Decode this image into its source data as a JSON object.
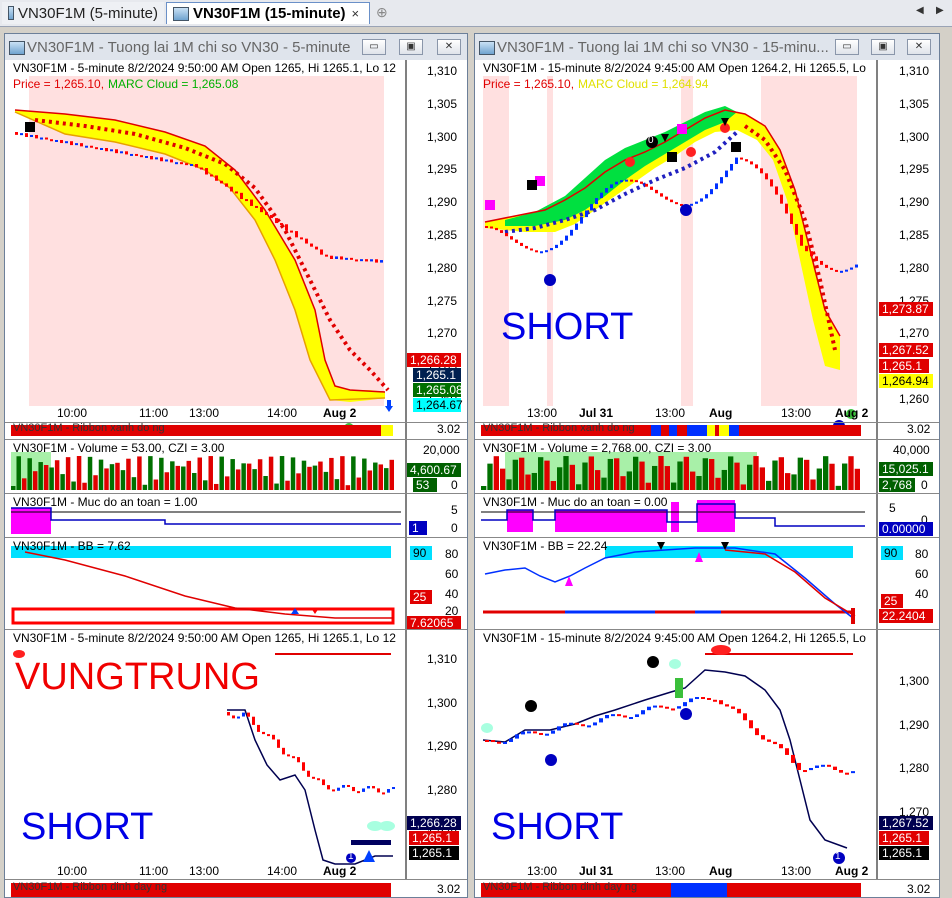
{
  "tabs": [
    {
      "label": "VN30F1M (5-minute)",
      "active": false
    },
    {
      "label": "VN30F1M (15-minute)",
      "active": true
    }
  ],
  "tab_close": "×",
  "tab_add": "⊕",
  "nav_left": "◀",
  "nav_right": "▶",
  "windows": {
    "left": {
      "title": "VN30F1M - Tuong lai 1M chi so VN30 - 5-minute",
      "price_header": "VN30F1M - 5-minute 8/2/2024 9:50:00 AM Open 1265, Hi 1265.1, Lo 12",
      "price_line": "Price = 1,265.10,",
      "marc_line": "MARC Cloud = 1,265.08",
      "y_ticks": [
        "1,310",
        "1,305",
        "1,300",
        "1,295",
        "1,290",
        "1,285",
        "1,280",
        "1,275",
        "1,270",
        "1,265",
        "1,260"
      ],
      "x_ticks": [
        "10:00",
        "11:00",
        "13:00",
        "14:00",
        "Aug 2"
      ],
      "price_tags": [
        "1,266.28",
        "1,265.1",
        "1,265.08",
        "1,264.67"
      ],
      "ribbon_label": "VN30F1M - Ribbon xanh do ng",
      "ribbon_value": "3.02",
      "volume_label": "VN30F1M - Volume = 53.00, CZI = 3.00",
      "volume_ticks": [
        "20,000",
        "0"
      ],
      "volume_tags": [
        "4,600.67",
        "53"
      ],
      "safety_label": "VN30F1M - Muc do an toan = 1.00",
      "safety_ticks": [
        "5",
        "0"
      ],
      "safety_tag": "1",
      "bb_label": "VN30F1M - BB = 7.62",
      "bb_ticks": [
        "80",
        "60",
        "40",
        "20"
      ],
      "bb_tags": [
        "90",
        "25",
        "7.62065"
      ],
      "bottom_header": "VN30F1M - 5-minute 8/2/2024 9:50:00 AM Open 1265, Hi 1265.1, Lo 12",
      "bottom_y_ticks": [
        "1,310",
        "1,300",
        "1,290",
        "1,280",
        "1,270"
      ],
      "bottom_tags": [
        "1,266.28",
        "1,265.1",
        "1,265.1"
      ],
      "bottom_x_ticks": [
        "10:00",
        "11:00",
        "13:00",
        "14:00",
        "Aug 2"
      ],
      "ribbon2_label": "VN30F1M - Ribbon dinh day ng",
      "ribbon2_value": "3.02",
      "vung_text": "VUNGTRUNG",
      "short_text": "SHORT",
      "marker_1": "1"
    },
    "right": {
      "title": "VN30F1M - Tuong lai 1M chi so VN30 - 15-minu...",
      "price_header": "VN30F1M - 15-minute 8/2/2024 9:45:00 AM Open 1264.2, Hi 1265.5, Lo",
      "price_line": "Price = 1,265.10,",
      "marc_line": "MARC Cloud = 1,264.94",
      "y_ticks": [
        "1,310",
        "1,305",
        "1,300",
        "1,295",
        "1,290",
        "1,285",
        "1,280",
        "1,275",
        "1,270",
        "1,265",
        "1,260"
      ],
      "x_ticks": [
        "13:00",
        "Jul 31",
        "13:00",
        "Aug",
        "13:00",
        "Aug 2"
      ],
      "price_tags": [
        "1,273.87",
        "1,267.52",
        "1,265.1",
        "1,264.94"
      ],
      "ribbon_label": "VN30F1M - Ribbon xanh do ng",
      "ribbon_value": "3.02",
      "volume_label": "VN30F1M - Volume = 2,768.00, CZI = 3.00",
      "volume_ticks": [
        "40,000",
        "0"
      ],
      "volume_tags": [
        "15,025.1",
        "2,768"
      ],
      "safety_label": "VN30F1M - Muc do an toan = 0.00",
      "safety_ticks": [
        "5",
        "0"
      ],
      "safety_tag": "0.00000",
      "bb_label": "VN30F1M - BB = 22.24",
      "bb_ticks": [
        "80",
        "60",
        "40",
        "20"
      ],
      "bb_tags": [
        "90",
        "25",
        "22.2404"
      ],
      "bottom_header": "VN30F1M - 15-minute 8/2/2024 9:45:00 AM Open 1264.2, Hi 1265.5, Lo",
      "bottom_y_ticks": [
        "1,300",
        "1,290",
        "1,280",
        "1,270"
      ],
      "bottom_tags": [
        "1,267.52",
        "1,265.1",
        "1,265.1"
      ],
      "bottom_x_ticks": [
        "13:00",
        "Jul 31",
        "13:00",
        "Aug",
        "13:00",
        "Aug 2"
      ],
      "ribbon2_label": "VN30F1M - Ribbon dinh day ng",
      "ribbon2_value": "3.02",
      "short_text": "SHORT",
      "short2_text": "SHORT",
      "marker_0": "0",
      "marker_1": "1"
    }
  },
  "window_buttons": [
    "▭",
    "▣",
    "✕"
  ],
  "colors": {
    "up": "#0030ff",
    "down": "#ff0000",
    "cloud": "#ffff00",
    "ema": "#e00000",
    "bg_short": "#ffe0e0",
    "tag_red": "#e00000",
    "tag_green": "#007000",
    "tag_cyan": "#00ffff",
    "magenta": "#ff00ff"
  }
}
